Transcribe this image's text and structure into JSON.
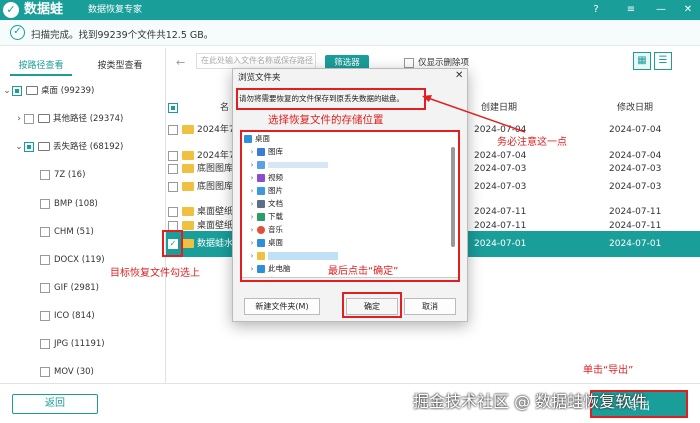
{
  "titlebar": {
    "app_name": "数据蛙",
    "subtitle": "数据恢复专家",
    "buttons": [
      "?",
      "≡",
      "—",
      "✕"
    ]
  },
  "status": {
    "text": "扫描完成。找到99239个文件共12.5 GB。"
  },
  "left_tabs": {
    "by_path": "按路径查看",
    "by_type": "按类型查看"
  },
  "tree": {
    "root": "桌面 (99239)",
    "other_path": "其他路径 (29374)",
    "lost_path": "丢失路径 (68192)",
    "types": [
      "7Z (16)",
      "BMP (108)",
      "CHM (51)",
      "DOCX (119)",
      "GIF (2981)",
      "ICO (814)",
      "JPG (11191)",
      "MOV (30)"
    ]
  },
  "toolbar": {
    "path_placeholder": "在此处输入文件名称或保存路径",
    "filter_label": "筛选器",
    "only_deleted": "仅显示删除项"
  },
  "table": {
    "headers": {
      "name": "名",
      "created": "创建日期",
      "modified": "修改日期"
    },
    "rows": [
      {
        "name": "2024年7月",
        "created": "2024-07-04",
        "modified": "2024-07-04"
      },
      {
        "name": "2024年7月",
        "created": "2024-07-04",
        "modified": "2024-07-04"
      },
      {
        "name": "底图图库",
        "created": "2024-07-03",
        "modified": "2024-07-03"
      },
      {
        "name": "底图图库",
        "created": "2024-07-03",
        "modified": "2024-07-03"
      },
      {
        "name": "桌面壁纸",
        "created": "2024-07-11",
        "modified": "2024-07-11"
      },
      {
        "name": "桌面壁纸",
        "created": "2024-07-11",
        "modified": "2024-07-11"
      },
      {
        "name": "数据蛙水印",
        "created": "2024-07-01",
        "modified": "2024-07-01"
      }
    ]
  },
  "dialog": {
    "title": "浏览文件夹",
    "close": "✕",
    "message": "请勿将需要恢复的文件保存到原丢失数据的磁盘。",
    "tree_items": [
      "桌面",
      "图库",
      "视频",
      "图片",
      "文档",
      "下载",
      "音乐",
      "桌面",
      "此电脑",
      "库"
    ],
    "new_folder": "新建文件夹(M)",
    "ok": "确定",
    "cancel": "取消"
  },
  "annotations": {
    "must_note": "务必注意这一点",
    "choose_location": "选择恢复文件的存储位置",
    "finally_click": "最后点击“确定”",
    "check_target": "目标恢复文件勾选上",
    "click_export": "单击“导出”"
  },
  "bottom": {
    "back": "返回",
    "export": "导出",
    "watermark": "掘金技术社区 @ 数据蛙恢复软件"
  },
  "colors": {
    "accent": "#1a9e9a",
    "annotation": "#e02020"
  }
}
